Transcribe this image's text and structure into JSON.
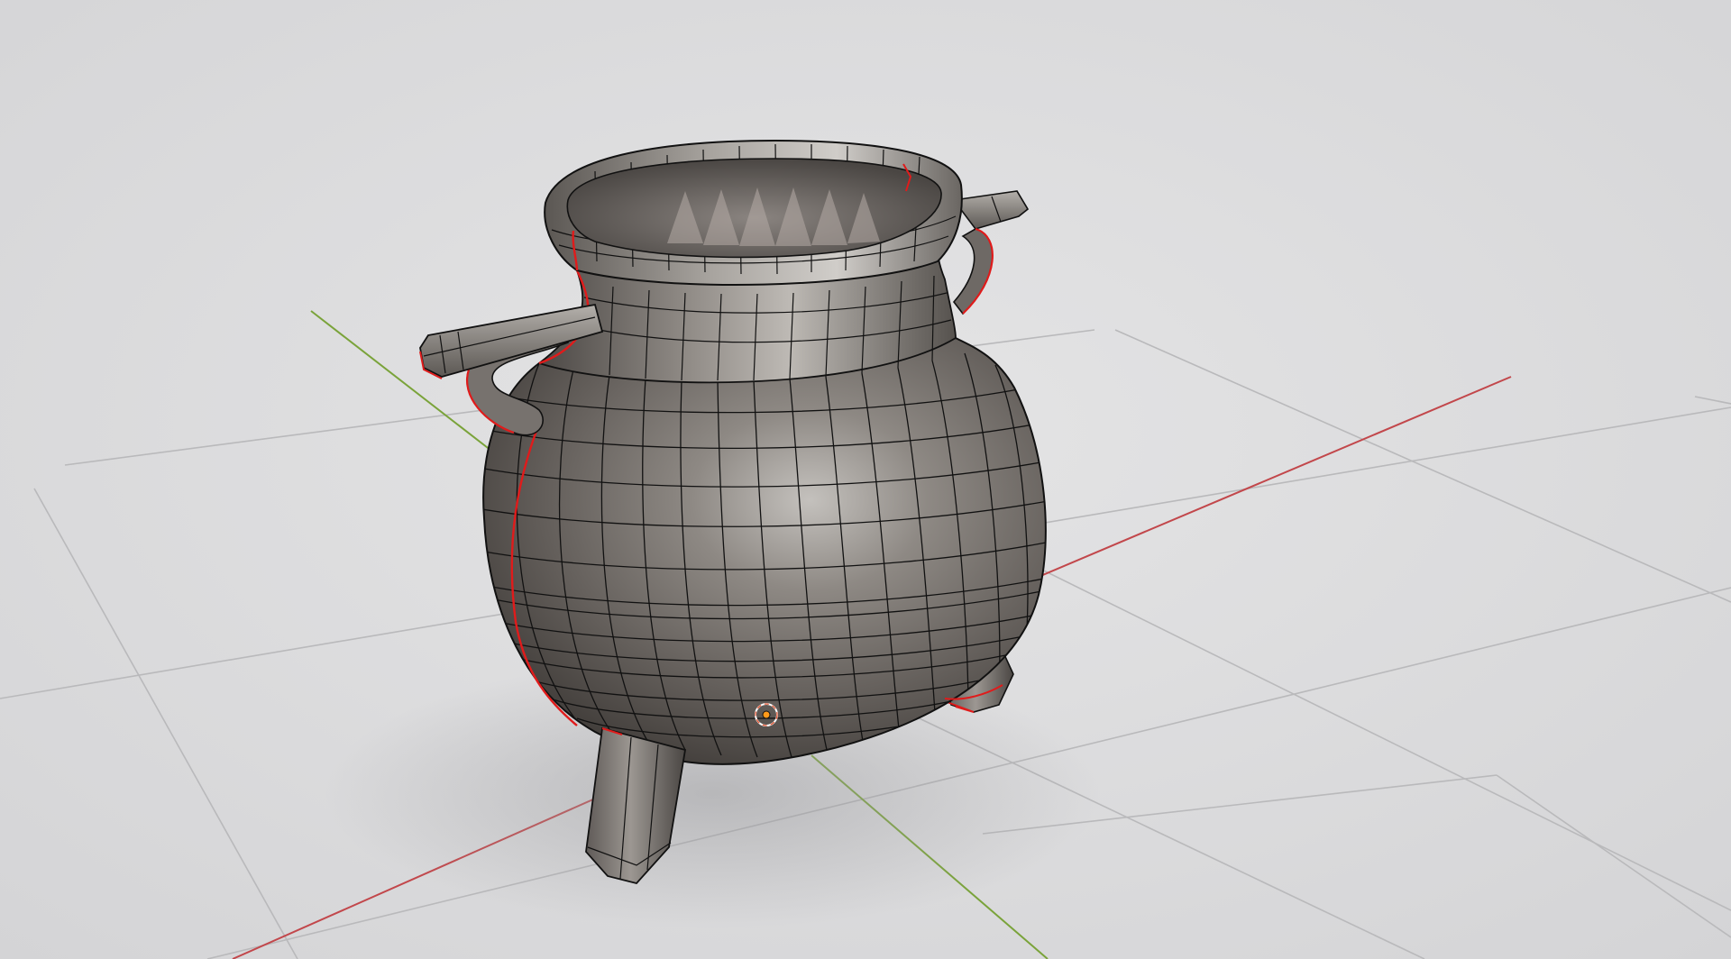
{
  "viewport": {
    "mode": "3D viewport",
    "background_color": "#dcdcdd",
    "floor_grid_color": "#b9b9bb",
    "x_axis_color": "#c2474b",
    "y_axis_color": "#7aa33a",
    "wireframe_color": "#111111",
    "seam_color": "#e01b1b",
    "metal_base_color": "#6f6a66",
    "origin_marker_color": "#ff9a1a"
  },
  "scene_object": {
    "name": "cauldron",
    "parts": [
      "rim",
      "neck",
      "body",
      "left-handle",
      "right-handle",
      "front-leg",
      "back-leg"
    ]
  }
}
